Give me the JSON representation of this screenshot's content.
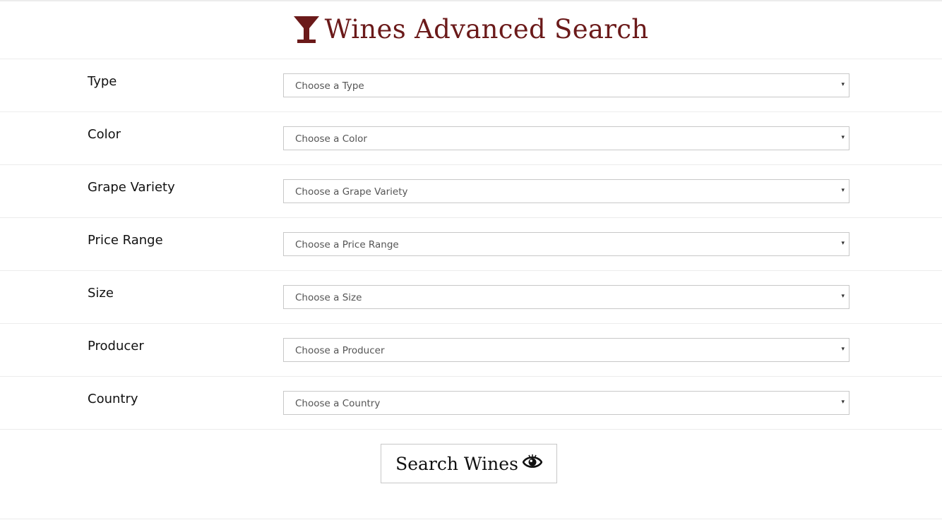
{
  "header": {
    "title": "Wines Advanced Search",
    "icon": "wine-glass-icon",
    "accent_color": "#6b1a1a"
  },
  "form": {
    "fields": [
      {
        "key": "type",
        "label": "Type",
        "placeholder": "Choose a Type"
      },
      {
        "key": "color",
        "label": "Color",
        "placeholder": "Choose a Color"
      },
      {
        "key": "grape_variety",
        "label": "Grape Variety",
        "placeholder": "Choose a Grape Variety"
      },
      {
        "key": "price_range",
        "label": "Price Range",
        "placeholder": "Choose a Price Range"
      },
      {
        "key": "size",
        "label": "Size",
        "placeholder": "Choose a Size"
      },
      {
        "key": "producer",
        "label": "Producer",
        "placeholder": "Choose a Producer"
      },
      {
        "key": "country",
        "label": "Country",
        "placeholder": "Choose a Country"
      }
    ],
    "caret": "▾"
  },
  "search_button": {
    "label": "Search Wines",
    "icon": "eye-icon"
  }
}
